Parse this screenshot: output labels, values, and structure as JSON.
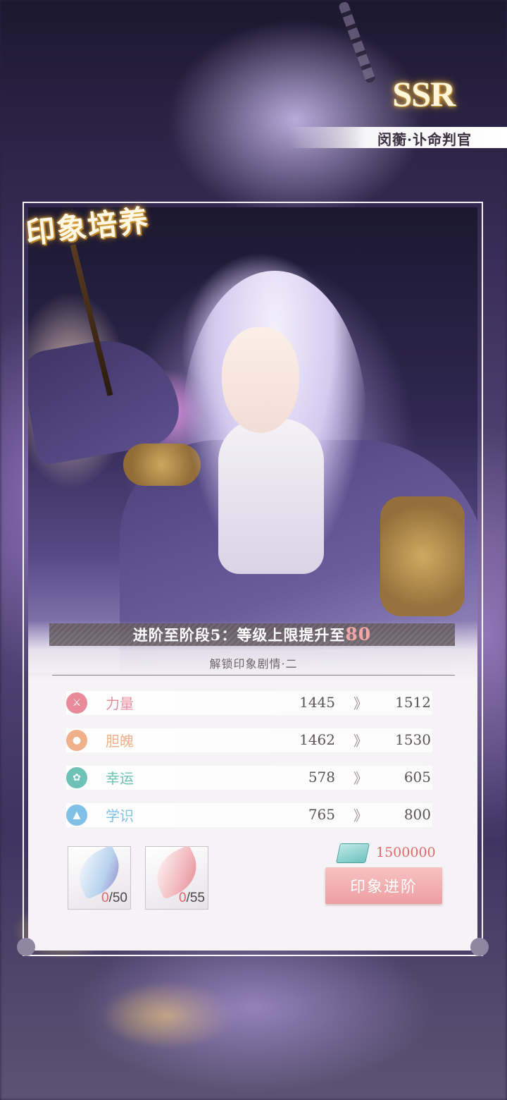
{
  "header": {
    "rarity": "SSR",
    "character_title": "闵蘅·讣命判官"
  },
  "card": {
    "badge": "印象培养"
  },
  "advance": {
    "stage_text": "进阶至阶段5：等级上限提升至",
    "level_cap": "80",
    "unlock_text": "解锁印象剧情·二"
  },
  "stats": [
    {
      "name": "力量",
      "from": "1445",
      "arrow": "》",
      "to": "1512",
      "color": "#e98a9a",
      "icon": "strength-icon"
    },
    {
      "name": "胆魄",
      "from": "1462",
      "arrow": "》",
      "to": "1530",
      "color": "#f0b08a",
      "icon": "courage-icon"
    },
    {
      "name": "幸运",
      "from": "578",
      "arrow": "》",
      "to": "605",
      "color": "#6ec1b6",
      "icon": "luck-icon"
    },
    {
      "name": "学识",
      "from": "765",
      "arrow": "》",
      "to": "800",
      "color": "#7fc0e6",
      "icon": "knowledge-icon"
    }
  ],
  "materials": [
    {
      "current": "0",
      "total": "/50",
      "icon": "blue-feather-icon"
    },
    {
      "current": "0",
      "total": "/55",
      "icon": "pink-feather-icon"
    }
  ],
  "cost": {
    "value": "1500000",
    "icon": "cash-stack-icon"
  },
  "button": {
    "label": "印象进阶"
  }
}
